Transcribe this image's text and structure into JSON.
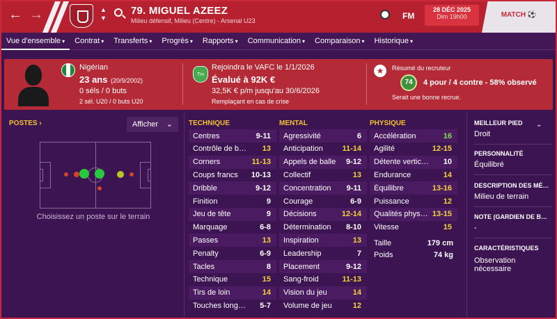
{
  "header": {
    "player_name": "79. MIGUEL AZEEZ",
    "player_sub": "Milieu défensif, Milieu (Centre) - Arsenal U23",
    "fm_label": "FM",
    "date": "28 DÉC 2025",
    "time": "Dim 19h00",
    "match_label": "MATCH ⚽",
    "colors": {
      "accent": "#b7202f",
      "background": "#3c1452",
      "gold": "#f4d23a",
      "green": "#7ee04e"
    }
  },
  "nav": {
    "items": [
      {
        "label": "Vue d'ensemble"
      },
      {
        "label": "Contrat"
      },
      {
        "label": "Transferts"
      },
      {
        "label": "Progrès"
      },
      {
        "label": "Rapports"
      },
      {
        "label": "Communication"
      },
      {
        "label": "Comparaison"
      },
      {
        "label": "Historique"
      }
    ]
  },
  "summary": {
    "nationality": "Nigérian",
    "age": "23 ans",
    "dob": "(20/9/2002)",
    "caps": "0 séls / 0 buts",
    "u20": "2 sél. U20 / 0 buts U20",
    "join": "Rejoindra le VAFC le 1/1/2026",
    "value": "Évalué à 92K €",
    "wage": "32,5K € p/m jusqu'au 30/6/2026",
    "status": "Remplaçant en cas de crise",
    "club_badge": "Tm",
    "scout_title": "Résumé du recruteur",
    "scout_rating": "74",
    "scout_line": "4 pour / 4 contre - 58% observé",
    "scout_comment": "Serait une bonne recrue."
  },
  "positions": {
    "title": "POSTES ›",
    "show_label": "Afficher",
    "hint": "Choisissez un poste sur le terrain"
  },
  "technique": {
    "title": "TECHNIQUE",
    "rows": [
      {
        "name": "Centres",
        "value": "9-11",
        "color": "w"
      },
      {
        "name": "Contrôle de balle",
        "value": "13",
        "color": "y"
      },
      {
        "name": "Corners",
        "value": "11-13",
        "color": "y"
      },
      {
        "name": "Coups francs",
        "value": "10-13",
        "color": "w"
      },
      {
        "name": "Dribble",
        "value": "9-12",
        "color": "w"
      },
      {
        "name": "Finition",
        "value": "9",
        "color": "w"
      },
      {
        "name": "Jeu de tête",
        "value": "9",
        "color": "w"
      },
      {
        "name": "Marquage",
        "value": "6-8",
        "color": "w"
      },
      {
        "name": "Passes",
        "value": "13",
        "color": "y"
      },
      {
        "name": "Penalty",
        "value": "6-9",
        "color": "w"
      },
      {
        "name": "Tacles",
        "value": "8",
        "color": "w"
      },
      {
        "name": "Technique",
        "value": "15",
        "color": "y"
      },
      {
        "name": "Tirs de loin",
        "value": "14",
        "color": "y"
      },
      {
        "name": "Touches longues",
        "value": "5-7",
        "color": "w"
      }
    ]
  },
  "mental": {
    "title": "MENTAL",
    "rows": [
      {
        "name": "Agressivité",
        "value": "6",
        "color": "w"
      },
      {
        "name": "Anticipation",
        "value": "11-14",
        "color": "y"
      },
      {
        "name": "Appels de balle",
        "value": "9-12",
        "color": "w"
      },
      {
        "name": "Collectif",
        "value": "13",
        "color": "y"
      },
      {
        "name": "Concentration",
        "value": "9-11",
        "color": "w"
      },
      {
        "name": "Courage",
        "value": "6-9",
        "color": "w"
      },
      {
        "name": "Décisions",
        "value": "12-14",
        "color": "y"
      },
      {
        "name": "Détermination",
        "value": "8-10",
        "color": "w"
      },
      {
        "name": "Inspiration",
        "value": "13",
        "color": "y"
      },
      {
        "name": "Leadership",
        "value": "7",
        "color": "w"
      },
      {
        "name": "Placement",
        "value": "9-12",
        "color": "w"
      },
      {
        "name": "Sang-froid",
        "value": "11-13",
        "color": "y"
      },
      {
        "name": "Vision du jeu",
        "value": "14",
        "color": "y"
      },
      {
        "name": "Volume de jeu",
        "value": "12",
        "color": "y"
      }
    ]
  },
  "physique": {
    "title": "PHYSIQUE",
    "rows": [
      {
        "name": "Accélération",
        "value": "16",
        "color": "g"
      },
      {
        "name": "Agilité",
        "value": "12-15",
        "color": "y"
      },
      {
        "name": "Détente verticale",
        "value": "10",
        "color": "w"
      },
      {
        "name": "Endurance",
        "value": "14",
        "color": "y"
      },
      {
        "name": "Équilibre",
        "value": "13-16",
        "color": "y"
      },
      {
        "name": "Puissance",
        "value": "12",
        "color": "y"
      },
      {
        "name": "Qualités physiques",
        "value": "13-15",
        "color": "y"
      },
      {
        "name": "Vitesse",
        "value": "15",
        "color": "y"
      }
    ],
    "height_label": "Taille",
    "height_value": "179 cm",
    "weight_label": "Poids",
    "weight_value": "74 kg"
  },
  "info": {
    "foot_title": "MEILLEUR PIED",
    "foot_value": "Droit",
    "personality_title": "PERSONNALITÉ",
    "personality_value": "Équilibré",
    "description_title": "DESCRIPTION DES MÉDIAS",
    "description_value": "Milieu de terrain",
    "note_title": "NOTE (GARDIEN DE BUT)",
    "note_value": "-",
    "traits_title": "CARACTÉRISTIQUES",
    "traits_value": "Observation nécessaire"
  }
}
